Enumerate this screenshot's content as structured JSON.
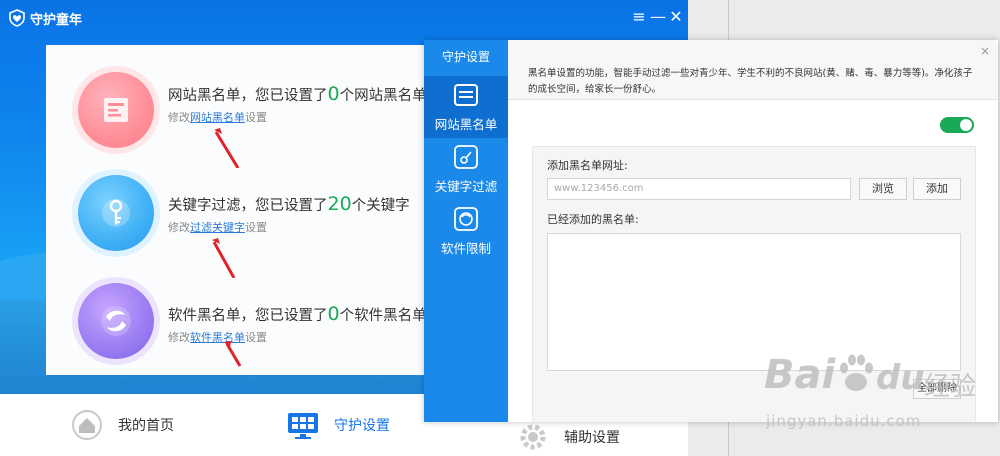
{
  "app": {
    "title": "守护童年",
    "controls": [
      "≡",
      "—",
      "✕"
    ]
  },
  "rows": [
    {
      "title_pre": "网站黑名单，您已设置了",
      "count": "0",
      "title_post": "个网站黑名单",
      "sub_pre": "修改",
      "sub_link": "网站黑名单",
      "sub_post": "设置",
      "icon": "document-icon"
    },
    {
      "title_pre": "关键字过滤，您已设置了",
      "count": "20",
      "title_post": "个关键字",
      "sub_pre": "修改",
      "sub_link": "过滤关键字",
      "sub_post": "设置",
      "icon": "key-icon"
    },
    {
      "title_pre": "软件黑名单，您已设置了",
      "count": "0",
      "title_post": "个软件黑名单",
      "sub_pre": "修改",
      "sub_link": "软件黑名单",
      "sub_post": "设置",
      "icon": "software-swirl-icon"
    }
  ],
  "bottom_nav": [
    {
      "label": "我的首页",
      "icon": "home-icon"
    },
    {
      "label": "守护设置",
      "icon": "monitor-icon",
      "active": true
    },
    {
      "label": "辅助设置",
      "icon": "gear-icon"
    }
  ],
  "dialog": {
    "header": "守护设置",
    "side_items": [
      {
        "label": "网站黑名单",
        "icon": "website-list-icon",
        "active": true
      },
      {
        "label": "关键字过滤",
        "icon": "filter-key-icon"
      },
      {
        "label": "软件限制",
        "icon": "software-limit-icon"
      }
    ],
    "description": "黑名单设置的功能，智能手动过滤一些对青少年、学生不利的不良网站(黄、赌、毒、暴力等等)。净化孩子的成长空间，给家长一份舒心。",
    "close": "×",
    "toggle_on": true,
    "add_label": "添加黑名单网址:",
    "url_placeholder": "www.123456.com",
    "browse_label": "浏览",
    "add_button": "添加",
    "list_label": "已经添加的黑名单:",
    "clear_button": "全部删除"
  },
  "watermark": {
    "brand": "Bai",
    "brand_tail": "du",
    "cn": "经验",
    "url": "jingyan.baidu.com"
  },
  "colors": {
    "accent_blue": "#1a89ea",
    "active_blue": "#1676e8",
    "count_green": "#1aaa55",
    "arrow_red": "#e0242a"
  }
}
